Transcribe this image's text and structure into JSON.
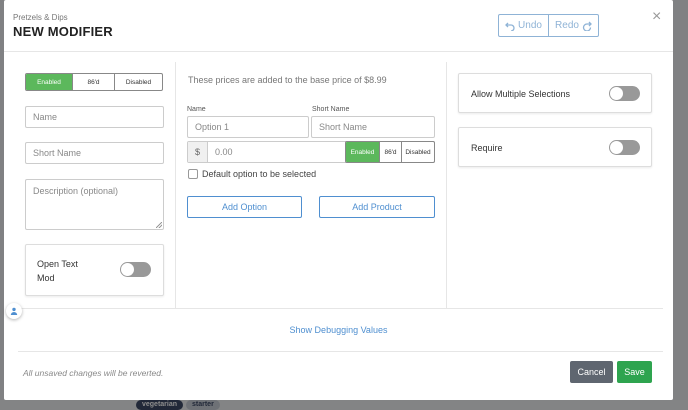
{
  "modal": {
    "subtitle": "Pretzels & Dips",
    "title": "NEW MODIFIER",
    "undo_label": "Undo",
    "redo_label": "Redo",
    "close_icon": "close-icon"
  },
  "left": {
    "status": {
      "options": [
        "Enabled",
        "86'd",
        "Disabled"
      ],
      "selected": "Enabled"
    },
    "name_placeholder": "Name",
    "short_name_placeholder": "Short Name",
    "description_placeholder": "Description (optional)",
    "open_text_mod_label": "Open Text Mod",
    "open_text_mod_on": false
  },
  "middle": {
    "info": "These prices are added to the base price of $8.99",
    "name_label": "Name",
    "short_name_label": "Short Name",
    "option_placeholder": "Option 1",
    "option_short_placeholder": "Short Name",
    "currency": "$",
    "price_value": "0.00",
    "status": {
      "options": [
        "Enabled",
        "86'd",
        "Disabled"
      ],
      "selected": "Enabled"
    },
    "default_label": "Default option to be selected",
    "default_checked": false,
    "add_option_label": "Add Option",
    "add_product_label": "Add Product"
  },
  "right": {
    "allow_multiple_label": "Allow Multiple Selections",
    "allow_multiple_on": false,
    "require_label": "Require",
    "require_on": false
  },
  "debug_link": "Show Debugging Values",
  "footer": {
    "note": "All unsaved changes will be reverted.",
    "cancel_label": "Cancel",
    "save_label": "Save"
  },
  "background": {
    "tags": [
      "vegetarian",
      "starter"
    ]
  },
  "colors": {
    "enabled_green": "#5cb85c",
    "save_green": "#2ea44f",
    "link_blue": "#4f8fd0",
    "cancel_gray": "#5f6670"
  }
}
